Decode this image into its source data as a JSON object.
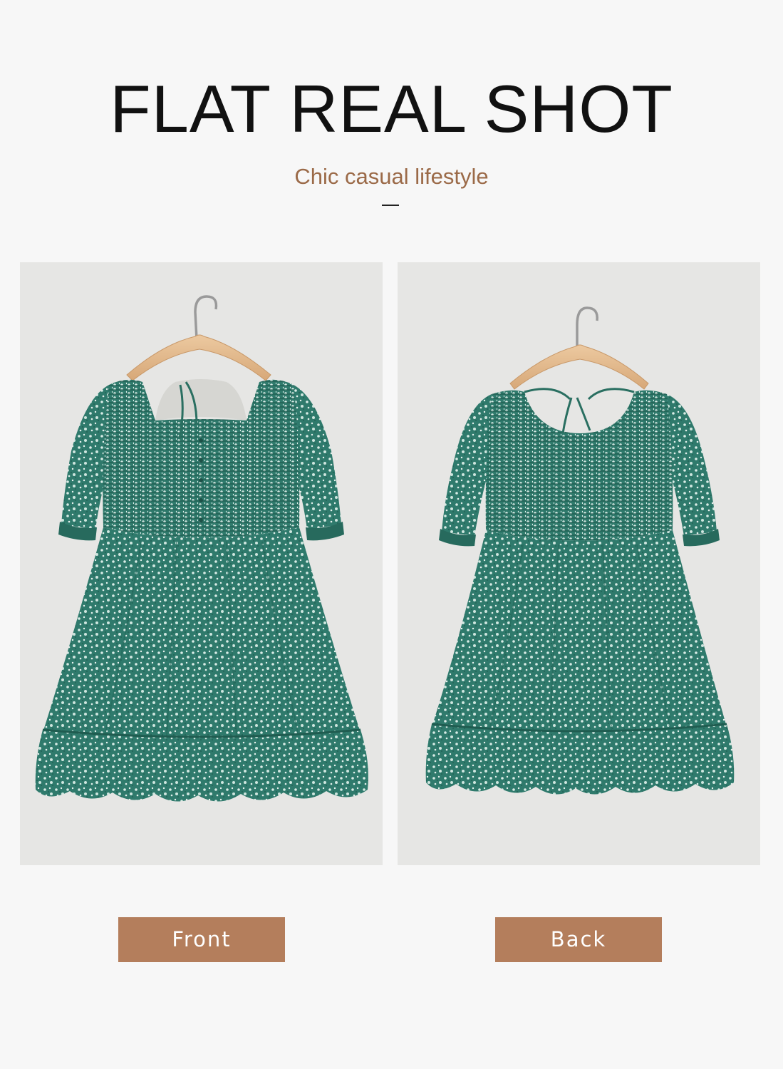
{
  "header": {
    "title": "FLAT REAL SHOT",
    "subtitle": "Chic casual lifestyle"
  },
  "colors": {
    "background": "#f7f7f7",
    "accent": "#b47e5c",
    "subtitle": "#9b6a48",
    "dress_green": "#2f7a6c",
    "photo_background": "#e6e6e4"
  },
  "photos": [
    {
      "name": "front-dress-photo",
      "icon": "dress-front-image"
    },
    {
      "name": "back-dress-photo",
      "icon": "dress-back-image"
    }
  ],
  "labels": {
    "front": "Front",
    "back": "Back"
  }
}
